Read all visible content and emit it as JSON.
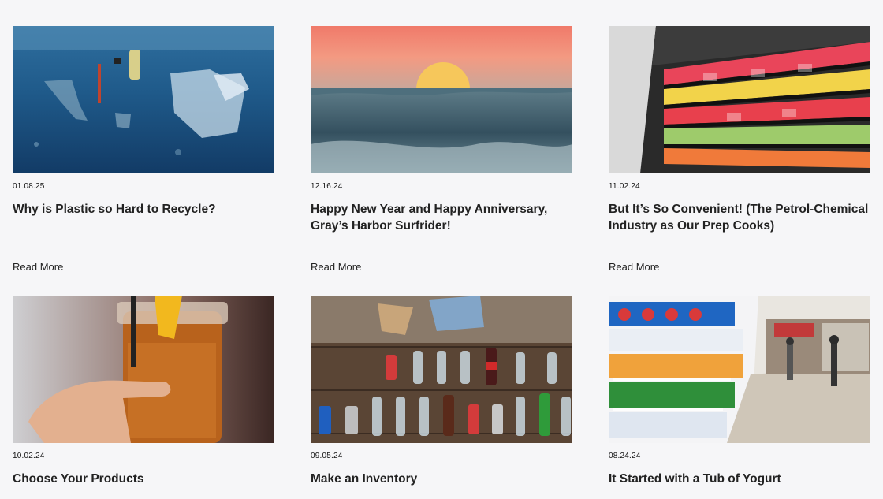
{
  "posts": [
    {
      "date": "01.08.25",
      "title": "Why is Plastic so Hard to Recycle?",
      "read_more": "Read More",
      "image": "plastic-in-ocean-image"
    },
    {
      "date": "12.16.24",
      "title": "Happy New Year and Happy Anniversary, Gray’s Harbor Surfrider!",
      "read_more": "Read More",
      "image": "sunset-wave-image"
    },
    {
      "date": "11.02.24",
      "title": "But It’s So Convenient! (The Petrol-Chemical Industry as Our Prep Cooks)",
      "read_more": "Read More",
      "image": "grocery-fruit-shelves-image"
    },
    {
      "date": "10.02.24",
      "title": "Choose Your Products",
      "image": "iced-tea-jar-image"
    },
    {
      "date": "09.05.24",
      "title": "Make an Inventory",
      "image": "plastic-bottles-inventory-image"
    },
    {
      "date": "08.24.24",
      "title": "It Started with a Tub of Yogurt",
      "image": "yogurt-aisle-image"
    }
  ]
}
